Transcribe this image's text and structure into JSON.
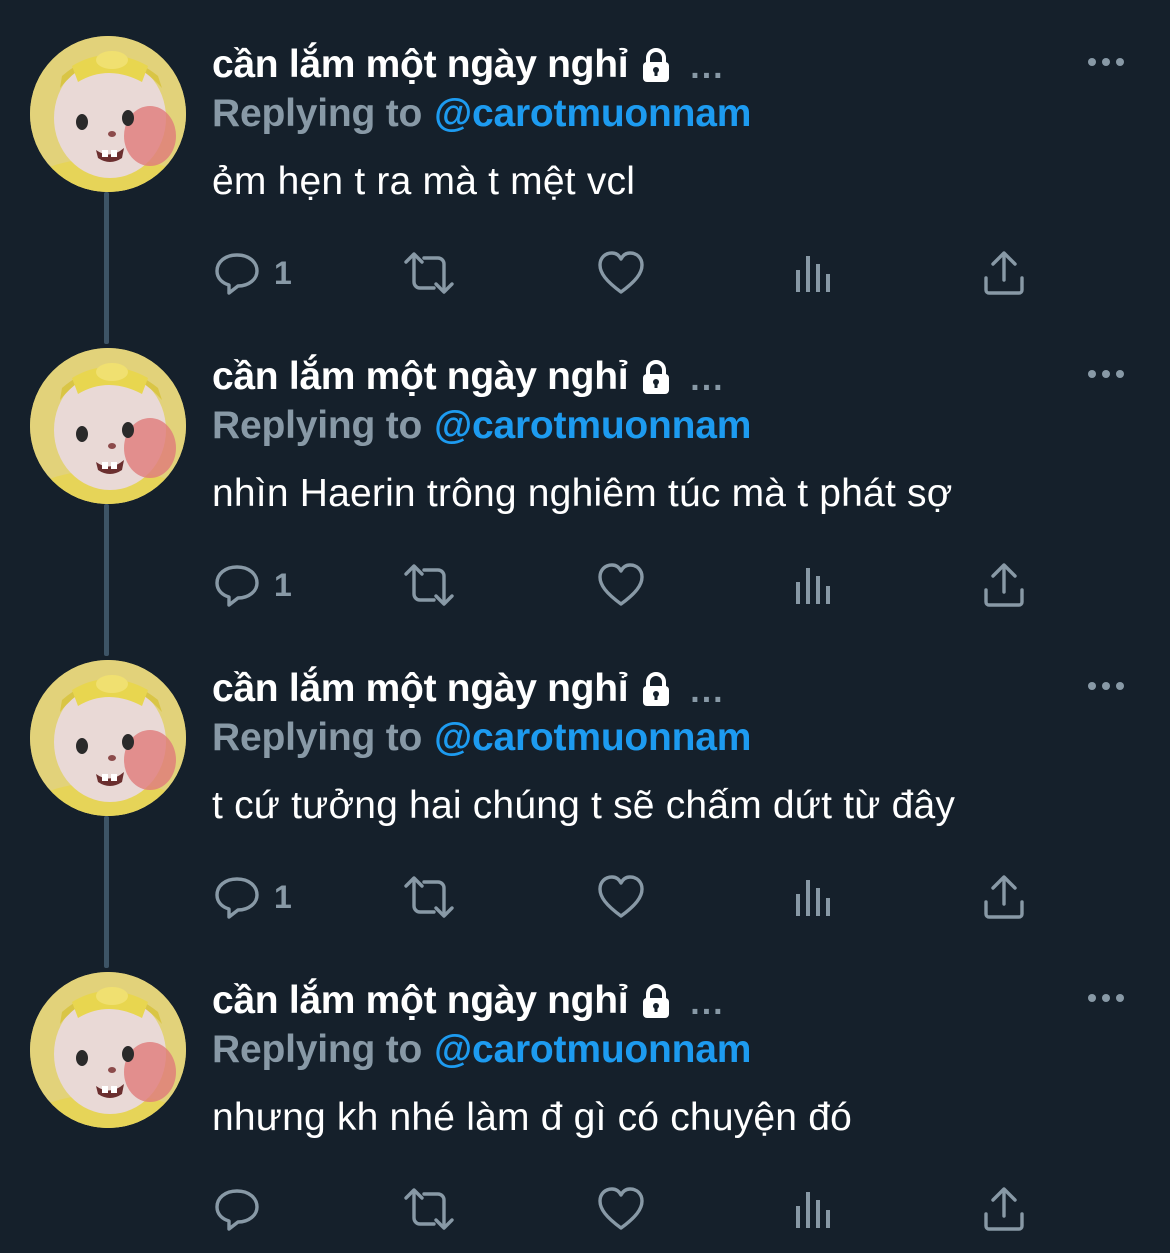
{
  "colors": {
    "background": "#15202b",
    "text_primary": "#ffffff",
    "text_secondary": "#8899a6",
    "accent": "#1d9bf0",
    "thread_line": "#3d5466"
  },
  "tweets": [
    {
      "display_name": "cần lắm một ngày nghỉ",
      "name_suffix": "...",
      "replying_prefix": "Replying to",
      "replying_handle": "@carotmuonnam",
      "text": "ẻm hẹn t ra mà t mệt vcl",
      "reply_count": "1"
    },
    {
      "display_name": "cần lắm một ngày nghỉ",
      "name_suffix": "...",
      "replying_prefix": "Replying to",
      "replying_handle": "@carotmuonnam",
      "text": "nhìn Haerin trông nghiêm túc mà t phát sợ",
      "reply_count": "1"
    },
    {
      "display_name": "cần lắm một ngày nghỉ",
      "name_suffix": "...",
      "replying_prefix": "Replying to",
      "replying_handle": "@carotmuonnam",
      "text": "t cứ tưởng hai chúng t sẽ chấm dứt từ đây",
      "reply_count": "1"
    },
    {
      "display_name": "cần lắm một ngày nghỉ",
      "name_suffix": "...",
      "replying_prefix": "Replying to",
      "replying_handle": "@carotmuonnam",
      "text": "nhưng kh nhé làm đ gì có chuyện đó",
      "reply_count": ""
    }
  ],
  "icons": {
    "lock": "lock-icon",
    "more": "more-dots-icon",
    "reply": "reply-bubble-icon",
    "retweet": "retweet-icon",
    "like": "heart-icon",
    "analytics": "analytics-bars-icon",
    "share": "share-upload-icon"
  }
}
